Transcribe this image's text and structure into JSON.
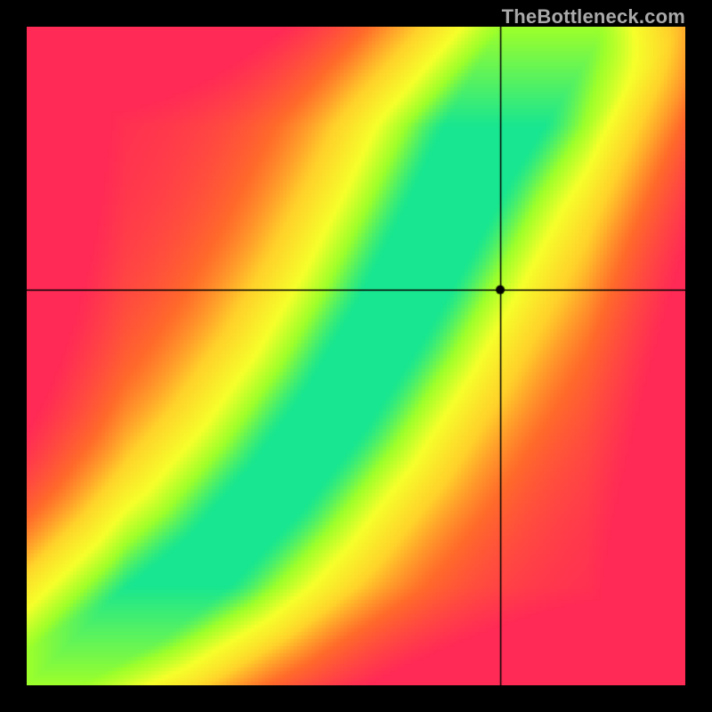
{
  "watermark": "TheBottleneck.com",
  "chart_data": {
    "type": "heatmap",
    "title": "",
    "xlabel": "",
    "ylabel": "",
    "xlim": [
      0,
      1
    ],
    "ylim": [
      0,
      1
    ],
    "marker": {
      "x": 0.72,
      "y": 0.6
    },
    "ridge": {
      "description": "normalized spline path of the green optimal band from bottom-left to top-right",
      "points": [
        [
          0.0,
          0.0
        ],
        [
          0.08,
          0.05
        ],
        [
          0.18,
          0.11
        ],
        [
          0.28,
          0.19
        ],
        [
          0.38,
          0.3
        ],
        [
          0.47,
          0.42
        ],
        [
          0.55,
          0.55
        ],
        [
          0.62,
          0.68
        ],
        [
          0.68,
          0.8
        ],
        [
          0.74,
          0.9
        ],
        [
          0.8,
          1.0
        ]
      ],
      "half_width": 0.042
    },
    "palette_stops": [
      {
        "t": 0.0,
        "color": "#ff2a55"
      },
      {
        "t": 0.25,
        "color": "#ff6a2a"
      },
      {
        "t": 0.5,
        "color": "#ffd22a"
      },
      {
        "t": 0.7,
        "color": "#f6ff2a"
      },
      {
        "t": 0.85,
        "color": "#9dff2a"
      },
      {
        "t": 1.0,
        "color": "#18e690"
      }
    ]
  }
}
